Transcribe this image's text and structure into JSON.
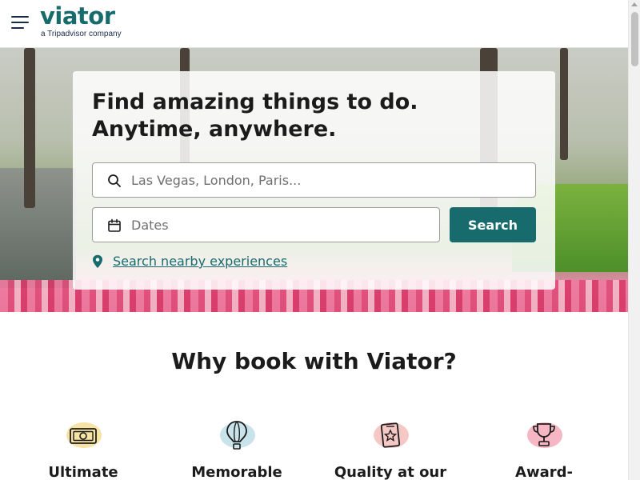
{
  "header": {
    "logo_word": "viator",
    "logo_tagline": "a Tripadvisor company"
  },
  "hero": {
    "headline_line1": "Find amazing things to do.",
    "headline_line2": "Anytime, anywhere.",
    "destination_placeholder": "Las Vegas, London, Paris...",
    "dates_placeholder": "Dates",
    "search_label": "Search",
    "nearby_label": "Search nearby experiences"
  },
  "why": {
    "title": "Why book with Viator?",
    "features": [
      {
        "label": "Ultimate",
        "icon": "cash-icon",
        "color": "#f7e3a3"
      },
      {
        "label": "Memorable",
        "icon": "hot-air-balloon-icon",
        "color": "#c8e3ea"
      },
      {
        "label": "Quality at our",
        "icon": "badge-star-icon",
        "color": "#f6c8c5"
      },
      {
        "label": "Award-",
        "icon": "trophy-icon",
        "color": "#f6b6c3"
      }
    ]
  },
  "colors": {
    "brand": "#186b6d",
    "navy": "#1a2b49"
  }
}
